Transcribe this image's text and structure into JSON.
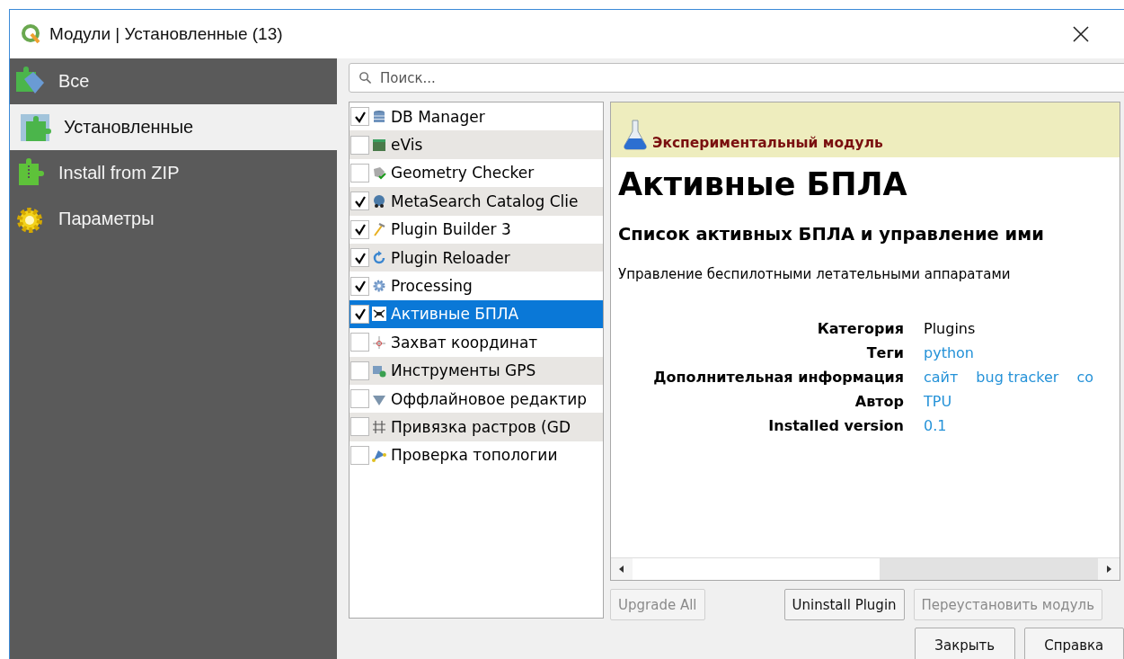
{
  "window": {
    "title": "Модули | Установленные (13)"
  },
  "sidebar": {
    "items": [
      {
        "label": "Все",
        "selected": false
      },
      {
        "label": "Установленные",
        "selected": true
      },
      {
        "label": "Install from ZIP",
        "selected": false
      },
      {
        "label": "Параметры",
        "selected": false
      }
    ]
  },
  "search": {
    "placeholder": "Поиск..."
  },
  "plugins": [
    {
      "name": "DB Manager",
      "checked": true,
      "selected": false
    },
    {
      "name": "eVis",
      "checked": false,
      "selected": false
    },
    {
      "name": "Geometry Checker",
      "checked": false,
      "selected": false
    },
    {
      "name": "MetaSearch Catalog Clie",
      "checked": true,
      "selected": false
    },
    {
      "name": "Plugin Builder 3",
      "checked": true,
      "selected": false
    },
    {
      "name": "Plugin Reloader",
      "checked": true,
      "selected": false
    },
    {
      "name": "Processing",
      "checked": true,
      "selected": false
    },
    {
      "name": "Активные БПЛА",
      "checked": true,
      "selected": true
    },
    {
      "name": "Захват координат",
      "checked": false,
      "selected": false
    },
    {
      "name": "Инструменты GPS",
      "checked": false,
      "selected": false
    },
    {
      "name": "Оффлайновое редактир",
      "checked": false,
      "selected": false
    },
    {
      "name": "Привязка растров (GD",
      "checked": false,
      "selected": false
    },
    {
      "name": "Проверка топологии",
      "checked": false,
      "selected": false
    }
  ],
  "details": {
    "banner": "Экспериментальный модуль",
    "title": "Активные БПЛА",
    "subtitle": "Список активных БПЛА и управление ими",
    "description": "Управление беспилотными летательными аппаратами",
    "fields": [
      {
        "label": "Категория",
        "values": [
          {
            "text": "Plugins",
            "kind": "text"
          }
        ]
      },
      {
        "label": "Теги",
        "values": [
          {
            "text": "python",
            "kind": "link"
          }
        ]
      },
      {
        "label": "Дополнительная информация",
        "values": [
          {
            "text": "сайт",
            "kind": "link"
          },
          {
            "text": "bug tracker",
            "kind": "link"
          },
          {
            "text": "co",
            "kind": "link"
          }
        ]
      },
      {
        "label": "Автор",
        "values": [
          {
            "text": "TPU",
            "kind": "link"
          }
        ]
      },
      {
        "label": "Installed version",
        "values": [
          {
            "text": "0.1",
            "kind": "link"
          }
        ]
      }
    ]
  },
  "action_buttons": [
    {
      "label": "Upgrade All",
      "disabled": true
    },
    {
      "label": "Uninstall Plugin",
      "disabled": false
    },
    {
      "label": "Переустановить модуль",
      "disabled": true
    }
  ],
  "dialog_buttons": [
    {
      "label": "Закрыть"
    },
    {
      "label": "Справка"
    }
  ]
}
